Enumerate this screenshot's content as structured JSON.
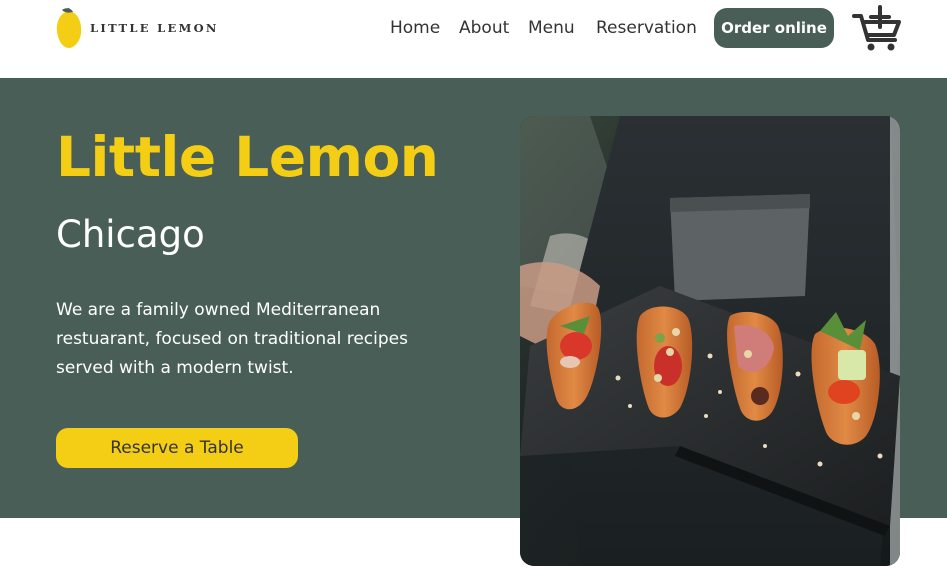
{
  "header": {
    "logo_text": "LITTLE LEMON",
    "nav": {
      "home": "Home",
      "about": "About",
      "menu": "Menu",
      "reservation": "Reservation"
    },
    "order_button": "Order online",
    "cart_icon": "cart-add-icon"
  },
  "hero": {
    "title": "Little Lemon",
    "subtitle": "Chicago",
    "description": "We are a family owned Mediterranean restuarant, focused on traditional recipes served with a modern twist.",
    "cta": "Reserve a Table",
    "image": "hero-food-photo"
  },
  "colors": {
    "primary_green": "#495e57",
    "primary_yellow": "#f4ce14",
    "text_dark": "#333333",
    "white": "#ffffff"
  }
}
